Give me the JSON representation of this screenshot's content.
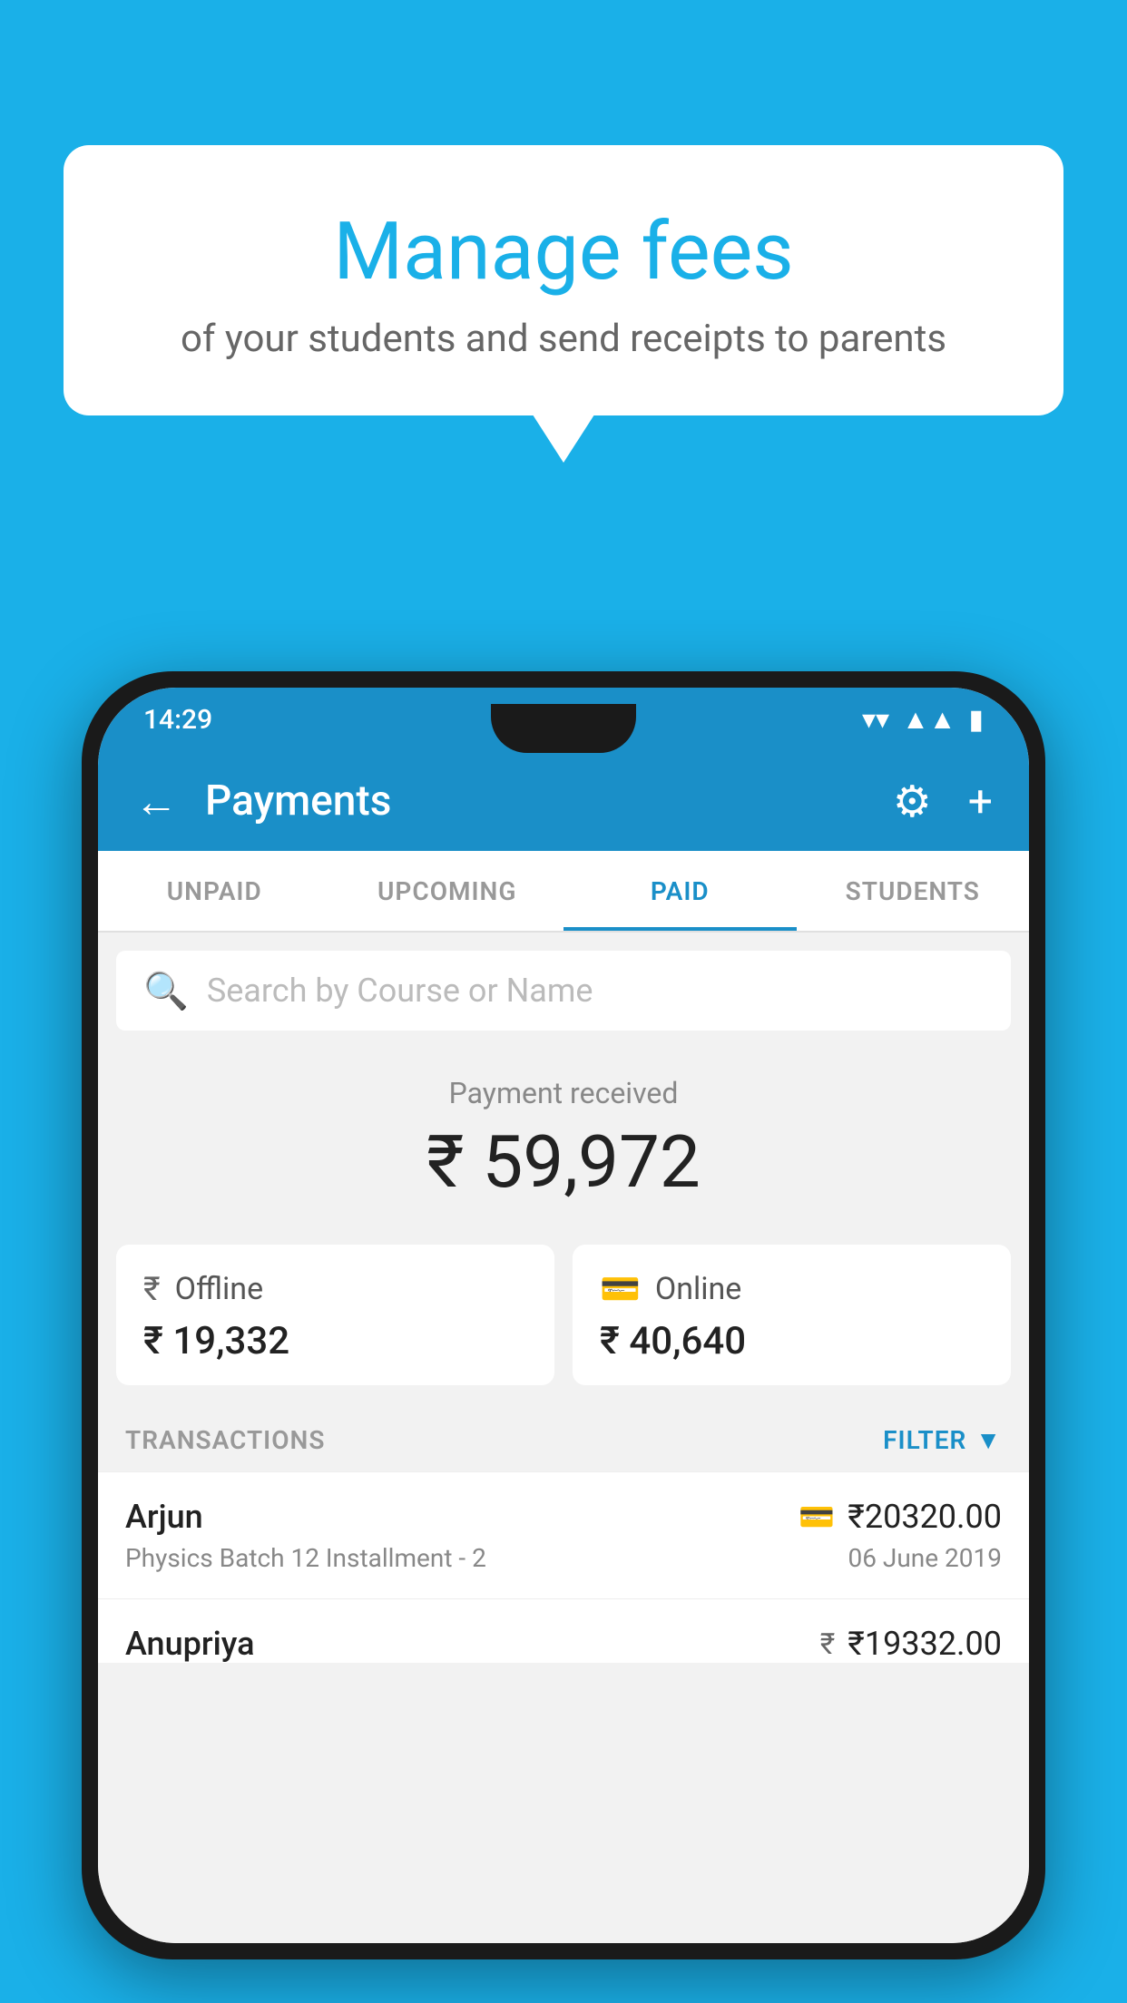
{
  "bubble": {
    "title": "Manage fees",
    "subtitle": "of your students and send receipts to parents"
  },
  "phone": {
    "status_bar": {
      "time": "14:29",
      "icons": [
        "wifi",
        "signal",
        "battery"
      ]
    },
    "toolbar": {
      "back_label": "←",
      "title": "Payments",
      "settings_label": "⚙",
      "add_label": "+"
    },
    "tabs": [
      {
        "label": "UNPAID",
        "active": false
      },
      {
        "label": "UPCOMING",
        "active": false
      },
      {
        "label": "PAID",
        "active": true
      },
      {
        "label": "STUDENTS",
        "active": false
      }
    ],
    "search": {
      "placeholder": "Search by Course or Name"
    },
    "payment_received": {
      "label": "Payment received",
      "amount": "₹ 59,972"
    },
    "cards": [
      {
        "icon": "rupee",
        "label": "Offline",
        "amount": "₹ 19,332"
      },
      {
        "icon": "card",
        "label": "Online",
        "amount": "₹ 40,640"
      }
    ],
    "transactions_label": "TRANSACTIONS",
    "filter_label": "FILTER",
    "transactions": [
      {
        "name": "Arjun",
        "amount": "₹20320.00",
        "course": "Physics Batch 12 Installment - 2",
        "date": "06 June 2019",
        "method_icon": "card"
      },
      {
        "name": "Anupriya",
        "amount": "₹19332.00",
        "course": "",
        "date": "",
        "method_icon": "rupee"
      }
    ]
  }
}
